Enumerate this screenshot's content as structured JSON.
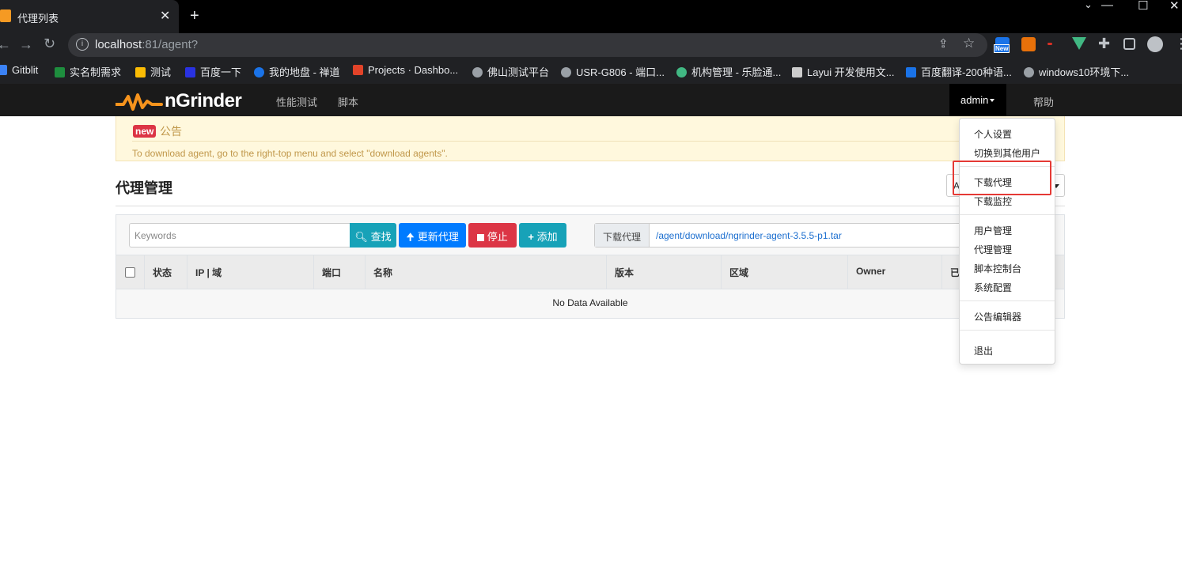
{
  "browser": {
    "tab_title": "代理列表",
    "close_glyph": "✕",
    "new_tab_glyph": "+",
    "window_controls": [
      "⌄",
      "—",
      "☐",
      "✕"
    ],
    "url_host": "localhost",
    "url_rest": ":81/agent?",
    "ext_new_badge": "New",
    "bookmarks": [
      {
        "label": "Gitblit",
        "color": "#3b82f6"
      },
      {
        "label": "实名制需求",
        "color": "#1e8e3e"
      },
      {
        "label": "测试",
        "color": "#fbbc04"
      },
      {
        "label": "百度一下",
        "color": "#2932e1"
      },
      {
        "label": "我的地盘 - 禅道",
        "color": "#1a73e8"
      },
      {
        "label": "Projects · Dashbo...",
        "color": "#e24329"
      },
      {
        "label": "佛山测试平台",
        "color": "#9aa0a6"
      },
      {
        "label": "USR-G806 - 端口...",
        "color": "#9aa0a6"
      },
      {
        "label": "机构管理 - 乐脸通...",
        "color": "#41b883"
      },
      {
        "label": "Layui 开发使用文...",
        "color": "#cccccc"
      },
      {
        "label": "百度翻译-200种语...",
        "color": "#1a73e8"
      },
      {
        "label": "windows10环境下...",
        "color": "#9aa0a6"
      }
    ]
  },
  "navbar": {
    "brand": "nGrinder",
    "links": [
      "性能测试",
      "脚本"
    ],
    "user": "admin",
    "help": "帮助"
  },
  "notice": {
    "badge": "new",
    "title": "公告",
    "text": "To download agent, go to the right-top menu and select \"download agents\"."
  },
  "page": {
    "title": "代理管理",
    "region_select": "A"
  },
  "toolbar": {
    "search_placeholder": "Keywords",
    "search_button": "查找",
    "update_button": "更新代理",
    "stop_button": "停止",
    "add_button": "添加",
    "download_label": "下载代理",
    "download_url": "/agent/download/ngrinder-agent-3.5.5-p1.tar"
  },
  "table": {
    "columns": [
      "状态",
      "IP | 域",
      "端口",
      "名称",
      "版本",
      "区域",
      "Owner",
      "已"
    ],
    "empty_text": "No Data Available"
  },
  "dropdown": {
    "items": [
      "个人设置",
      "切换到其他用户",
      "下载代理",
      "下载监控",
      "用户管理",
      "代理管理",
      "脚本控制台",
      "系统配置",
      "公告编辑器",
      "退出"
    ]
  },
  "colors": {
    "search_btn": "#17a2b8",
    "update_btn": "#007bff",
    "stop_btn": "#dc3545",
    "add_btn": "#17a2b8",
    "highlight": "#e53935",
    "brand_orange": "#f7941d"
  }
}
